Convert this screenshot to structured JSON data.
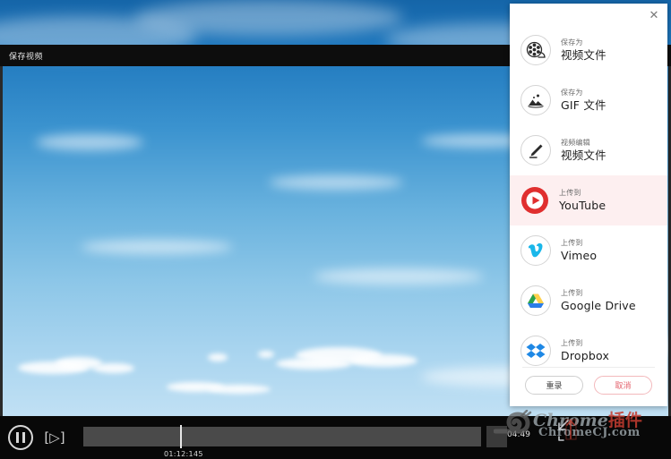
{
  "window": {
    "title": "保存视频"
  },
  "player": {
    "pause_icon": "pause-icon",
    "step_label": "[▷]",
    "current_time": "01:12:145",
    "total_time": "04:49"
  },
  "watermark": {
    "snail_glyph": "🐌",
    "line1_en": "Chrome",
    "line1_cn": "插件",
    "line2": "ChromeCJ.com"
  },
  "save_panel": {
    "close_label": "✕",
    "options": [
      {
        "sub": "保存为",
        "main": "视频文件",
        "icon": "film-reel-icon"
      },
      {
        "sub": "保存为",
        "main": "GIF 文件",
        "icon": "image-landscape-icon"
      },
      {
        "sub": "视频编辑",
        "main": "视频文件",
        "icon": "pencil-edit-icon"
      },
      {
        "sub": "上传到",
        "main": "YouTube",
        "icon": "youtube-icon"
      },
      {
        "sub": "上传到",
        "main": "Vimeo",
        "icon": "vimeo-icon"
      },
      {
        "sub": "上传到",
        "main": "Google Drive",
        "icon": "google-drive-icon"
      },
      {
        "sub": "上传到",
        "main": "Dropbox",
        "icon": "dropbox-icon"
      }
    ],
    "active_index": 3,
    "actions": {
      "rerecord_label": "重录",
      "cancel_label": "取消"
    }
  },
  "colors": {
    "youtube_red": "#e02f2f",
    "vimeo_blue": "#1ab7ea",
    "dropbox_blue": "#1e88e5",
    "highlight_bg": "#fdeff0",
    "cancel_text": "#e4626c"
  }
}
